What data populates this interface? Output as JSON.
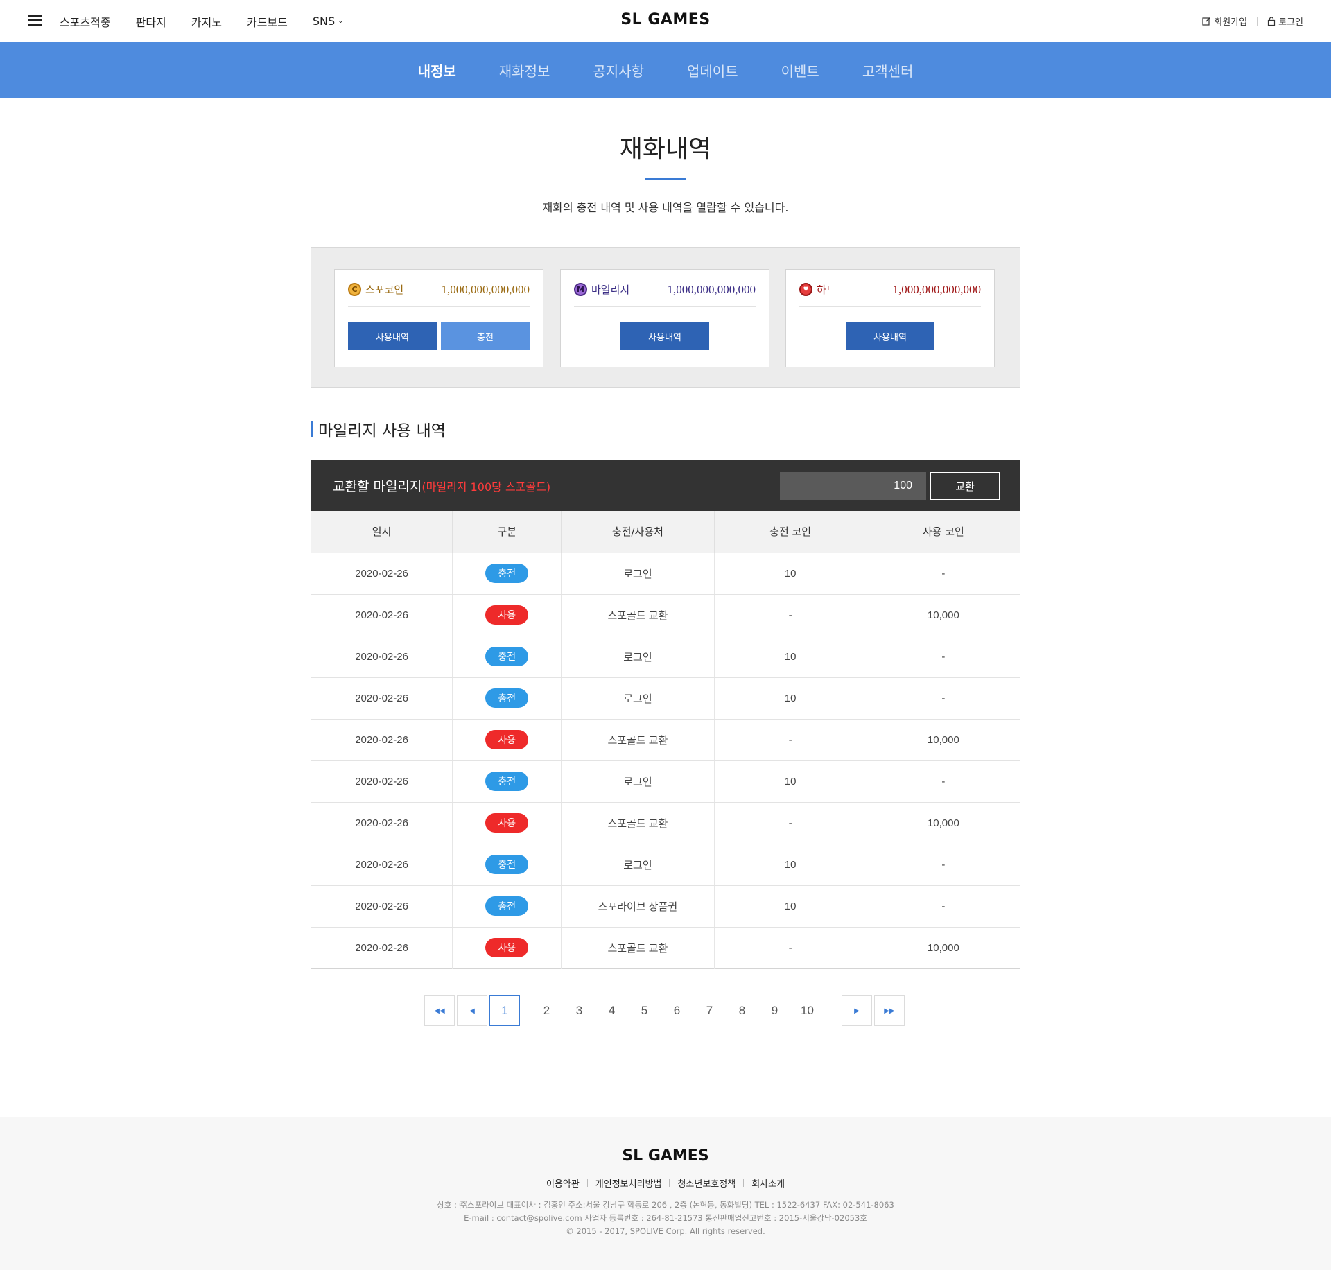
{
  "top": {
    "nav": [
      "스포츠적중",
      "판타지",
      "카지노",
      "카드보드",
      "SNS"
    ],
    "logo": "SL GAMES",
    "signup": "회원가입",
    "login": "로그인"
  },
  "subnav": [
    "내정보",
    "재화정보",
    "공지사항",
    "업데이트",
    "이벤트",
    "고객센터"
  ],
  "page": {
    "title": "재화내역",
    "desc": "재화의 충전 내역 및 사용 내역을 열람할 수 있습니다."
  },
  "wallets": [
    {
      "icon_letter": "C",
      "name": "스포코인",
      "value": "1,000,000,000,000",
      "btn1": "사용내역",
      "btn2": "충전"
    },
    {
      "icon_letter": "M",
      "name": "마일리지",
      "value": "1,000,000,000,000",
      "btn1": "사용내역"
    },
    {
      "icon_letter": "♥",
      "name": "하트",
      "value": "1,000,000,000,000",
      "btn1": "사용내역"
    }
  ],
  "section": {
    "title": "마일리지 사용 내역"
  },
  "exchange": {
    "label": "교환할 마일리지",
    "note": "(마일리지 100당 스포골드)",
    "value": "100",
    "button": "교환"
  },
  "table": {
    "headers": [
      "일시",
      "구분",
      "충전/사용처",
      "충전 코인",
      "사용 코인"
    ],
    "rows": [
      {
        "date": "2020-02-26",
        "type": "충전",
        "kind": "charge",
        "where": "로그인",
        "charge": "10",
        "use": "-"
      },
      {
        "date": "2020-02-26",
        "type": "사용",
        "kind": "use",
        "where": "스포골드 교환",
        "charge": "-",
        "use": "10,000"
      },
      {
        "date": "2020-02-26",
        "type": "충전",
        "kind": "charge",
        "where": "로그인",
        "charge": "10",
        "use": "-"
      },
      {
        "date": "2020-02-26",
        "type": "충전",
        "kind": "charge",
        "where": "로그인",
        "charge": "10",
        "use": "-"
      },
      {
        "date": "2020-02-26",
        "type": "사용",
        "kind": "use",
        "where": "스포골드 교환",
        "charge": "-",
        "use": "10,000"
      },
      {
        "date": "2020-02-26",
        "type": "충전",
        "kind": "charge",
        "where": "로그인",
        "charge": "10",
        "use": "-"
      },
      {
        "date": "2020-02-26",
        "type": "사용",
        "kind": "use",
        "where": "스포골드 교환",
        "charge": "-",
        "use": "10,000"
      },
      {
        "date": "2020-02-26",
        "type": "충전",
        "kind": "charge",
        "where": "로그인",
        "charge": "10",
        "use": "-"
      },
      {
        "date": "2020-02-26",
        "type": "충전",
        "kind": "charge",
        "where": "스포라이브 상품권",
        "charge": "10",
        "use": "-"
      },
      {
        "date": "2020-02-26",
        "type": "사용",
        "kind": "use",
        "where": "스포골드 교환",
        "charge": "-",
        "use": "10,000"
      }
    ]
  },
  "pager": {
    "current": "1",
    "pages": [
      "2",
      "3",
      "4",
      "5",
      "6",
      "7",
      "8",
      "9",
      "10"
    ]
  },
  "footer": {
    "logo": "SL GAMES",
    "links": [
      "이용약관",
      "개인정보처리방법",
      "청소년보호정책",
      "회사소개"
    ],
    "info1": "상호 : ㈜스포라이브 대표이사 : 김홍인  주소:서울 강남구 학동로 206 , 2층 (논현동, 동화빌딩)  TEL : 1522-6437 FAX: 02-541-8063",
    "info2": "E-mail : contact@spolive.com 사업자 등록번호 : 264-81-21573 통신판매업신고번호 : 2015-서울강남-02053호",
    "info3": "© 2015 - 2017, SPOLIVE Corp. All rights reserved."
  },
  "colors": {
    "blue_nav": "#4e8bde",
    "btn_dark": "#2e63b4",
    "btn_light": "#5a93e0",
    "badge_charge": "#2e9ae6",
    "badge_use": "#ee2a2a",
    "exchange_bar": "#333333"
  }
}
